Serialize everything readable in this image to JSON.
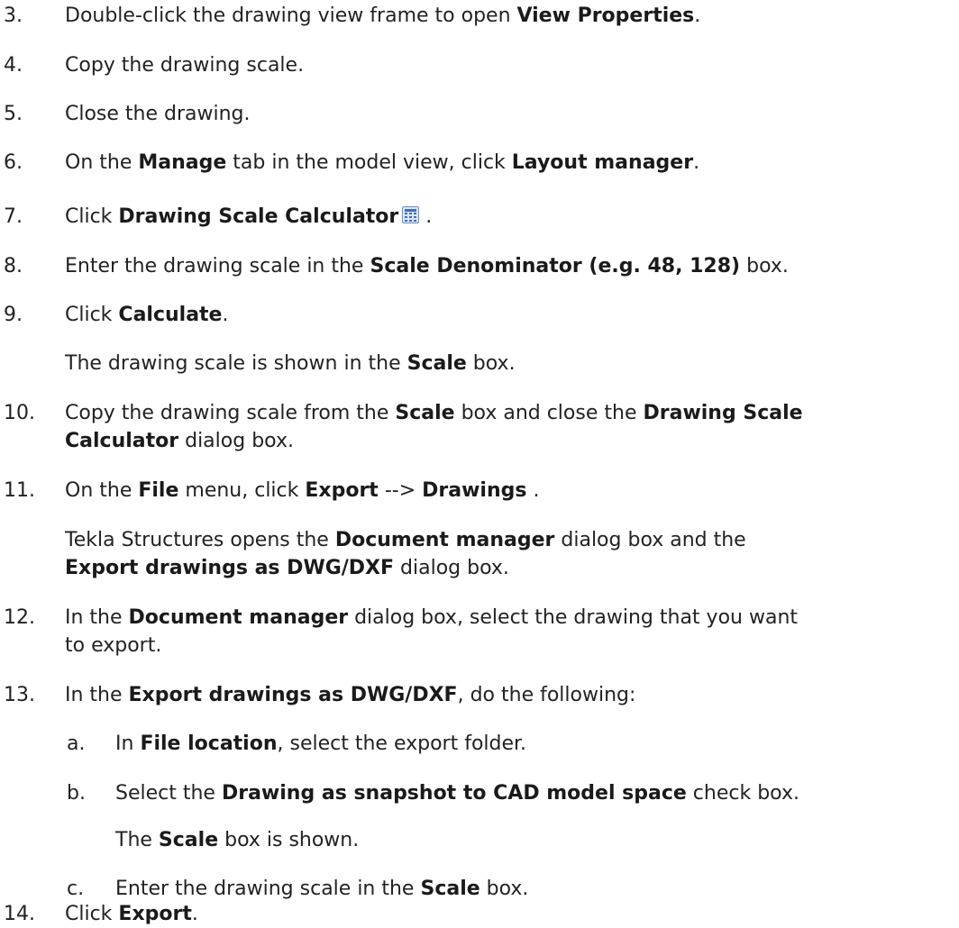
{
  "steps": {
    "s3": {
      "num": "3.",
      "t1": "Double-click the drawing view frame to open ",
      "b1": "View Properties",
      "t2": "."
    },
    "s4": {
      "num": "4.",
      "t1": "Copy the drawing scale."
    },
    "s5": {
      "num": "5.",
      "t1": "Close the drawing."
    },
    "s6": {
      "num": "6.",
      "t1": "On the ",
      "b1": "Manage",
      "t2": " tab in the model view, click ",
      "b2": "Layout manager",
      "t3": "."
    },
    "s7": {
      "num": "7.",
      "t1": "Click ",
      "b1": "Drawing Scale Calculator",
      "t2": " .",
      "icon": "calculator-icon"
    },
    "s8": {
      "num": "8.",
      "t1": "Enter the drawing scale in the ",
      "b1": "Scale Denominator (e.g. 48, 128)",
      "t2": " box."
    },
    "s9": {
      "num": "9.",
      "t1": "Click ",
      "b1": "Calculate",
      "t2": "."
    },
    "s9r": {
      "t1": "The drawing scale is shown in the ",
      "b1": "Scale",
      "t2": " box."
    },
    "s10": {
      "num": "10.",
      "t1": "Copy the drawing scale from the ",
      "b1": "Scale",
      "t2": " box and close the ",
      "b2": "Drawing Scale",
      "b3": "Calculator",
      "t3": " dialog box."
    },
    "s11": {
      "num": "11.",
      "t1": "On the ",
      "b1": "File",
      "t2": " menu, click ",
      "b2": "Export",
      "t3": " --> ",
      "b3": "Drawings",
      "t4": " ."
    },
    "s11r": {
      "t1": "Tekla Structures opens the ",
      "b1": "Document manager",
      "t2": " dialog box and the",
      "b2": "Export drawings as DWG/DXF",
      "t3": " dialog box."
    },
    "s12": {
      "num": "12.",
      "t1": "In the ",
      "b1": "Document manager",
      "t2": " dialog box, select the drawing that you want",
      "t3": "to export."
    },
    "s13": {
      "num": "13.",
      "t1": "In the ",
      "b1": "Export drawings as DWG/DXF",
      "t2": ", do the following:"
    },
    "s13a": {
      "num": "a.",
      "t1": "In ",
      "b1": "File location",
      "t2": ", select the export folder."
    },
    "s13b": {
      "num": "b.",
      "t1": "Select the ",
      "b1": "Drawing as snapshot to CAD model space",
      "t2": " check box."
    },
    "s13br": {
      "t1": "The ",
      "b1": "Scale",
      "t2": " box is shown."
    },
    "s13c": {
      "num": "c.",
      "t1": "Enter the drawing scale in the ",
      "b1": "Scale",
      "t2": " box."
    },
    "s14": {
      "num": "14.",
      "t1": "Click ",
      "b1": "Export",
      "t2": "."
    }
  }
}
